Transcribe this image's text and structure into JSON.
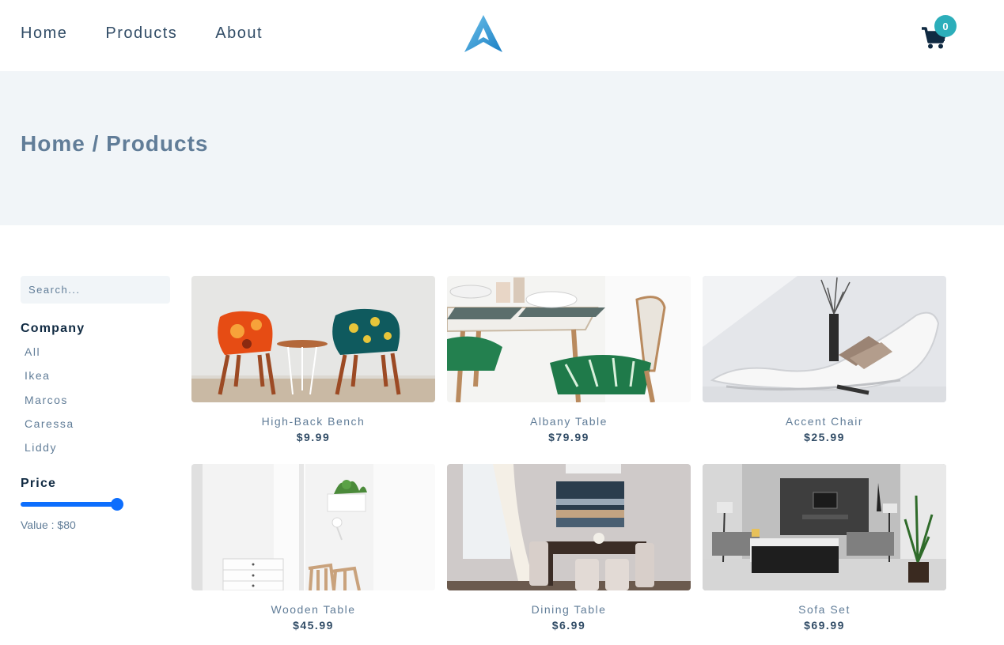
{
  "nav": {
    "links": [
      "Home",
      "Products",
      "About"
    ],
    "cart_count": "0"
  },
  "hero": {
    "title": "Home / Products"
  },
  "filters": {
    "search_placeholder": "Search...",
    "company_heading": "Company",
    "companies": [
      "All",
      "Ikea",
      "Marcos",
      "Caressa",
      "Liddy"
    ],
    "price_heading": "Price",
    "price_value": "Value : $80",
    "price_slider_level": 1.0
  },
  "products": [
    {
      "name": "High-Back Bench",
      "price": "$9.99"
    },
    {
      "name": "Albany Table",
      "price": "$79.99"
    },
    {
      "name": "Accent Chair",
      "price": "$25.99"
    },
    {
      "name": "Wooden Table",
      "price": "$45.99"
    },
    {
      "name": "Dining Table",
      "price": "$6.99"
    },
    {
      "name": "Sofa Set",
      "price": "$69.99"
    }
  ],
  "colors": {
    "accent": "#2caeba",
    "slider": "#0d6efd",
    "hero_bg": "#f1f5f8",
    "text_muted": "#617d98"
  }
}
